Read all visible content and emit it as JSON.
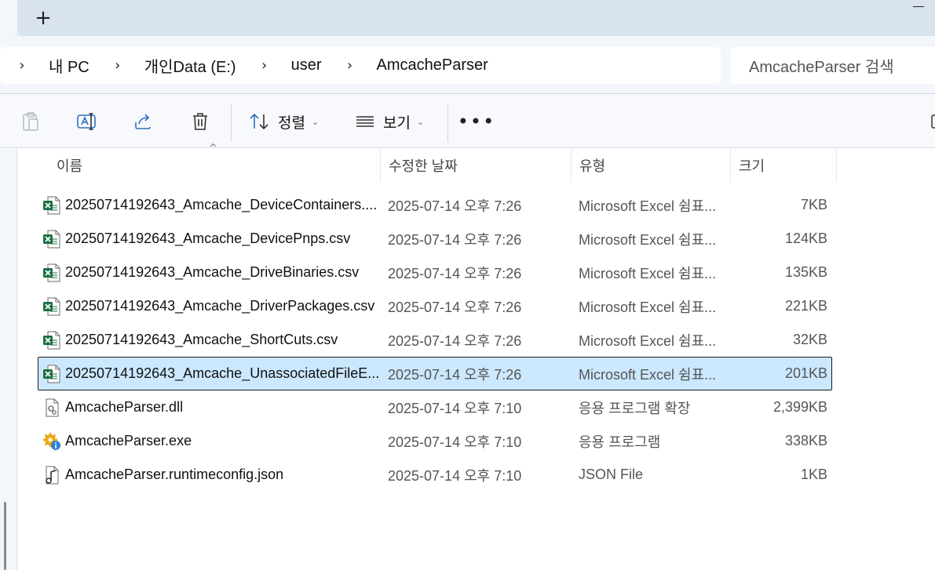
{
  "tabstrip": {
    "new_tab_label": "+"
  },
  "breadcrumb": {
    "items": [
      "내 PC",
      "개인Data (E:)",
      "user",
      "AmcacheParser"
    ]
  },
  "search": {
    "placeholder": "AmcacheParser 검색"
  },
  "toolbar": {
    "sort_label": "정렬",
    "view_label": "보기",
    "more_label": "•••",
    "caret": "⌄"
  },
  "columns": {
    "name": "이름",
    "date": "수정한 날짜",
    "type": "유형",
    "size": "크기",
    "sort_indicator": "^"
  },
  "files": [
    {
      "name": "20250714192643_Amcache_DeviceContainers....",
      "date": "2025-07-14 오후 7:26",
      "type": "Microsoft Excel 쉼표...",
      "size": "7KB",
      "icon": "excel-csv-icon",
      "selected": false
    },
    {
      "name": "20250714192643_Amcache_DevicePnps.csv",
      "date": "2025-07-14 오후 7:26",
      "type": "Microsoft Excel 쉼표...",
      "size": "124KB",
      "icon": "excel-csv-icon",
      "selected": false
    },
    {
      "name": "20250714192643_Amcache_DriveBinaries.csv",
      "date": "2025-07-14 오후 7:26",
      "type": "Microsoft Excel 쉼표...",
      "size": "135KB",
      "icon": "excel-csv-icon",
      "selected": false
    },
    {
      "name": "20250714192643_Amcache_DriverPackages.csv",
      "date": "2025-07-14 오후 7:26",
      "type": "Microsoft Excel 쉼표...",
      "size": "221KB",
      "icon": "excel-csv-icon",
      "selected": false
    },
    {
      "name": "20250714192643_Amcache_ShortCuts.csv",
      "date": "2025-07-14 오후 7:26",
      "type": "Microsoft Excel 쉼표...",
      "size": "32KB",
      "icon": "excel-csv-icon",
      "selected": false
    },
    {
      "name": "20250714192643_Amcache_UnassociatedFileE...",
      "date": "2025-07-14 오후 7:26",
      "type": "Microsoft Excel 쉼표...",
      "size": "201KB",
      "icon": "excel-csv-icon",
      "selected": true
    },
    {
      "name": "AmcacheParser.dll",
      "date": "2025-07-14 오후 7:10",
      "type": "응용 프로그램 확장",
      "size": "2,399KB",
      "icon": "dll-file-icon",
      "selected": false
    },
    {
      "name": "AmcacheParser.exe",
      "date": "2025-07-14 오후 7:10",
      "type": "응용 프로그램",
      "size": "338KB",
      "icon": "exe-gear-icon",
      "selected": false
    },
    {
      "name": "AmcacheParser.runtimeconfig.json",
      "date": "2025-07-14 오후 7:10",
      "type": "JSON File",
      "size": "1KB",
      "icon": "json-file-icon",
      "selected": false
    }
  ],
  "colors": {
    "selection_bg": "#cce8ff",
    "excel_green": "#1d7044",
    "accent_blue": "#2f6fc4"
  }
}
